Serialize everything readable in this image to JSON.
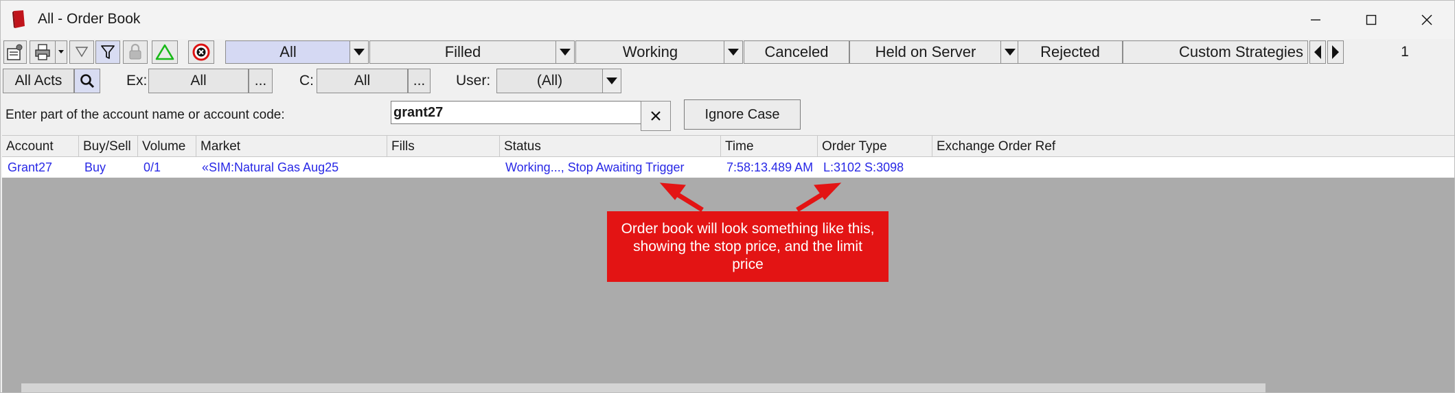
{
  "window": {
    "title": "All - Order Book",
    "icons": [
      "order-book-app-icon",
      "minimize-icon",
      "maximize-icon",
      "close-icon"
    ]
  },
  "toolbar": {
    "icons": [
      "properties-icon",
      "print-icon",
      "print-menu-icon",
      "filter-outline-icon",
      "filter-icon",
      "lock-icon",
      "triangle-icon",
      "cancel-all-icon"
    ],
    "tabs": [
      "All",
      "Filled",
      "Working",
      "Canceled",
      "Held on Server",
      "Rejected",
      "Custom Strategies"
    ],
    "page_count": "1"
  },
  "filters": {
    "account_button": "All Acts",
    "exchange_label": "Ex:",
    "exchange_value": "All",
    "exchange_more": "...",
    "contract_label": "C:",
    "contract_value": "All",
    "contract_more": "...",
    "user_label": "User:",
    "user_value": "(All)"
  },
  "search": {
    "hint": "Enter part of the account name or account code:",
    "value": "grant27",
    "ignore_case_label": "Ignore Case"
  },
  "table": {
    "columns": [
      "Account",
      "Buy/Sell",
      "Volume",
      "Market",
      "Fills",
      "Status",
      "Time",
      "Order Type",
      "Exchange Order Ref"
    ],
    "rows": [
      {
        "account": "Grant27",
        "buy_sell": "Buy",
        "volume": "0/1",
        "market": "«SIM:Natural Gas Aug25",
        "fills": "",
        "status": "Working..., Stop Awaiting Trigger",
        "time": "7:58:13.489 AM",
        "order_type": "L:3102 S:3098",
        "exchange_order_ref": ""
      }
    ]
  },
  "annotation": {
    "text": "Order book will look something like this, showing the stop price, and the limit price",
    "color": "#e31414"
  },
  "colors": {
    "active_tab": "#d5d9f3",
    "row_text": "#2828e6",
    "grid_background": "#ababab"
  }
}
